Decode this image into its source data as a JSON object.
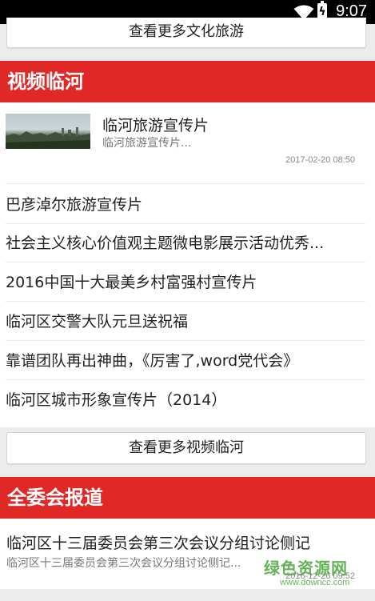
{
  "status_bar": {
    "time": "9:07"
  },
  "culture": {
    "more_label": "查看更多文化旅游"
  },
  "video_section": {
    "header": "视频临河",
    "featured": {
      "title": "临河旅游宣传片",
      "summary": "临河旅游宣传片...",
      "date": "2017-02-20 08:50"
    },
    "items": [
      "巴彦淖尔旅游宣传片",
      "社会主义核心价值观主题微电影展示活动优秀...",
      "2016中国十大最美乡村富强村宣传片",
      "临河区交警大队元旦送祝福",
      "靠谱团队再出神曲，《厉害了,word党代会》",
      "临河区城市形象宣传片（2014）"
    ],
    "more_label": "查看更多视频临河"
  },
  "committee_section": {
    "header": "全委会报道",
    "item": {
      "title": "临河区十三届委员会第三次会议分组讨论侧记",
      "summary": "临河区十三届委员会第三次会议分组讨论侧记...",
      "date": "2016-12-26 09:52"
    }
  },
  "watermark": {
    "main": "绿色资源网",
    "url": "www.downcc.com"
  },
  "colors": {
    "accent": "#e02827",
    "watermark": "#4aa83a"
  },
  "icons": {
    "wifi": "wifi-icon",
    "battery": "battery-charging-icon"
  }
}
